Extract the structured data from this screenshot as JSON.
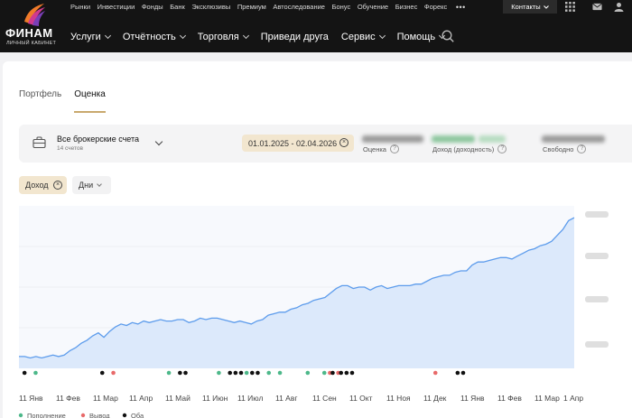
{
  "header": {
    "logo_text": "ФИНАМ",
    "logo_sub": "ЛИЧНЫЙ КАБИНЕТ",
    "top_links": [
      "Рынки",
      "Инвестиции",
      "Фонды",
      "Банк",
      "Эксклюзивы",
      "Премиум",
      "Автоследование",
      "Бонус",
      "Обучение",
      "Бизнес",
      "Форекс"
    ],
    "more_label": "•••",
    "contacts_label": "Контакты",
    "main_nav": [
      {
        "label": "Услуги"
      },
      {
        "label": "Отчётность"
      },
      {
        "label": "Торговля"
      },
      {
        "label": "Приведи друга"
      },
      {
        "label": "Сервис"
      },
      {
        "label": "Помощь"
      }
    ]
  },
  "tabs": [
    {
      "label": "Портфель",
      "active": false
    },
    {
      "label": "Оценка",
      "active": true
    }
  ],
  "account": {
    "title": "Все брокерские счета",
    "subtitle": "14 счетов",
    "date_range": "01.01.2025 - 02.04.2026",
    "stats": [
      {
        "label": "Оценка"
      },
      {
        "label": "Доход (доходность)"
      },
      {
        "label": "Свободно"
      }
    ]
  },
  "filters": {
    "income_label": "Доход",
    "period_label": "Дни"
  },
  "colors": {
    "header_bg": "#141414",
    "accent": "#c9a96e",
    "chip_bg": "#f2e6cf",
    "line": "#5d9cec",
    "area": "#dce9fb",
    "deposit": "#4db88a",
    "withdraw": "#e86a6a",
    "both": "#111111"
  },
  "chart_data": {
    "type": "area",
    "x_ticks": [
      "11 Янв",
      "11 Фев",
      "11 Мар",
      "11 Апр",
      "11 Май",
      "11 Июн",
      "11 Июл",
      "11 Авг",
      "11 Сен",
      "11 Окт",
      "11 Ноя",
      "11 Дек",
      "11 Янв",
      "11 Фев",
      "11 Мар",
      "1 Апр"
    ],
    "y_ticks_hidden": true,
    "series": [
      {
        "values": [
          0.08,
          0.08,
          0.07,
          0.08,
          0.07,
          0.08,
          0.09,
          0.08,
          0.09,
          0.12,
          0.14,
          0.17,
          0.19,
          0.22,
          0.24,
          0.21,
          0.25,
          0.28,
          0.3,
          0.29,
          0.31,
          0.3,
          0.32,
          0.31,
          0.32,
          0.33,
          0.32,
          0.32,
          0.33,
          0.33,
          0.31,
          0.32,
          0.34,
          0.33,
          0.34,
          0.34,
          0.33,
          0.32,
          0.31,
          0.32,
          0.31,
          0.3,
          0.32,
          0.33,
          0.36,
          0.37,
          0.38,
          0.38,
          0.4,
          0.41,
          0.43,
          0.44,
          0.46,
          0.47,
          0.48,
          0.51,
          0.54,
          0.56,
          0.56,
          0.54,
          0.55,
          0.55,
          0.53,
          0.55,
          0.56,
          0.54,
          0.55,
          0.56,
          0.56,
          0.56,
          0.57,
          0.57,
          0.59,
          0.61,
          0.62,
          0.63,
          0.63,
          0.65,
          0.66,
          0.66,
          0.7,
          0.72,
          0.72,
          0.73,
          0.74,
          0.75,
          0.75,
          0.74,
          0.76,
          0.78,
          0.8,
          0.81,
          0.83,
          0.84,
          0.86,
          0.9,
          0.94,
          1.0,
          1.02
        ]
      }
    ],
    "markers": [
      {
        "x": 0.01,
        "kind": "both"
      },
      {
        "x": 0.03,
        "kind": "deposit"
      },
      {
        "x": 0.15,
        "kind": "both"
      },
      {
        "x": 0.17,
        "kind": "withdraw"
      },
      {
        "x": 0.27,
        "kind": "deposit"
      },
      {
        "x": 0.29,
        "kind": "both"
      },
      {
        "x": 0.3,
        "kind": "both"
      },
      {
        "x": 0.36,
        "kind": "deposit"
      },
      {
        "x": 0.38,
        "kind": "both"
      },
      {
        "x": 0.39,
        "kind": "both"
      },
      {
        "x": 0.4,
        "kind": "both"
      },
      {
        "x": 0.41,
        "kind": "deposit"
      },
      {
        "x": 0.42,
        "kind": "both"
      },
      {
        "x": 0.43,
        "kind": "both"
      },
      {
        "x": 0.45,
        "kind": "deposit"
      },
      {
        "x": 0.47,
        "kind": "deposit"
      },
      {
        "x": 0.52,
        "kind": "deposit"
      },
      {
        "x": 0.55,
        "kind": "deposit"
      },
      {
        "x": 0.56,
        "kind": "withdraw"
      },
      {
        "x": 0.565,
        "kind": "both"
      },
      {
        "x": 0.575,
        "kind": "withdraw"
      },
      {
        "x": 0.58,
        "kind": "both"
      },
      {
        "x": 0.59,
        "kind": "both"
      },
      {
        "x": 0.6,
        "kind": "both"
      },
      {
        "x": 0.75,
        "kind": "withdraw"
      },
      {
        "x": 0.79,
        "kind": "both"
      },
      {
        "x": 0.8,
        "kind": "both"
      }
    ],
    "legend": [
      {
        "kind": "deposit",
        "label": "Пополнение"
      },
      {
        "kind": "withdraw",
        "label": "Вывод"
      },
      {
        "kind": "both",
        "label": "Оба"
      }
    ]
  }
}
